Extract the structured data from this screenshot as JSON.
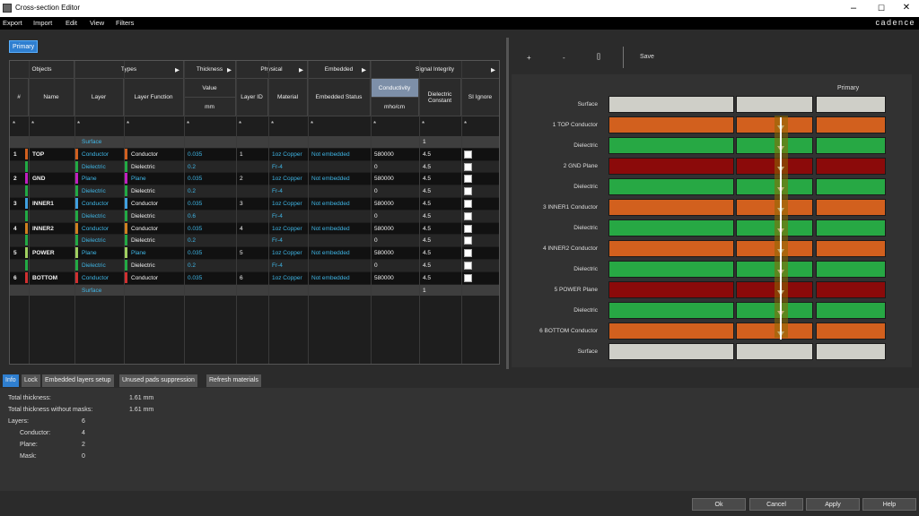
{
  "window": {
    "title": "Cross-section Editor",
    "min": "–",
    "max": "☐",
    "close": "✕",
    "brand": "cadence"
  },
  "menu": [
    "Export",
    "Import",
    "Edit",
    "View",
    "Filters"
  ],
  "primary_tab": "Primary",
  "headers": {
    "objects": "Objects",
    "types": "Types",
    "thickness": "Thickness",
    "physical": "Physical",
    "embedded": "Embedded",
    "signal_integrity": "Signal Integrity",
    "num": "#",
    "name": "Name",
    "layer": "Layer",
    "layer_function": "Layer Function",
    "value": "Value",
    "mm": "mm",
    "layer_id": "Layer ID",
    "material": "Material",
    "embedded_status": "Embedded Status",
    "conductivity": "Conductivity",
    "mho": "mho/cm",
    "dielectric_constant": "Dielectric Constant",
    "si_ignore": "SI Ignore",
    "star": "*"
  },
  "rows": [
    {
      "num": "",
      "name": "",
      "layer": "Surface",
      "func": "",
      "val": "",
      "id": "",
      "mat": "",
      "emb": "",
      "cond": "",
      "dk": "1",
      "chk": false,
      "type": "surface"
    },
    {
      "num": "1",
      "name": "TOP",
      "layer": "Conductor",
      "func": "Conductor",
      "val": "0.035",
      "id": "1",
      "mat": "1oz Copper",
      "emb": "Not embedded",
      "cond": "580000",
      "dk": "4.5",
      "chk": true,
      "type": "cond",
      "color": "#d06020"
    },
    {
      "num": "",
      "name": "",
      "layer": "Dielectric",
      "func": "Dielectric",
      "val": "0.2",
      "id": "",
      "mat": "Fr-4",
      "emb": "",
      "cond": "0",
      "dk": "4.5",
      "chk": true,
      "type": "diel",
      "color": "#22aa44"
    },
    {
      "num": "2",
      "name": "GND",
      "layer": "Plane",
      "func": "Plane",
      "val": "0.035",
      "id": "2",
      "mat": "1oz Copper",
      "emb": "Not embedded",
      "cond": "580000",
      "dk": "4.5",
      "chk": true,
      "type": "plane",
      "color": "#c020c0"
    },
    {
      "num": "",
      "name": "",
      "layer": "Dielectric",
      "func": "Dielectric",
      "val": "0.2",
      "id": "",
      "mat": "Fr-4",
      "emb": "",
      "cond": "0",
      "dk": "4.5",
      "chk": true,
      "type": "diel",
      "color": "#22aa44"
    },
    {
      "num": "3",
      "name": "INNER1",
      "layer": "Conductor",
      "func": "Conductor",
      "val": "0.035",
      "id": "3",
      "mat": "1oz Copper",
      "emb": "Not embedded",
      "cond": "580000",
      "dk": "4.5",
      "chk": true,
      "type": "cond",
      "color": "#40a0e0"
    },
    {
      "num": "",
      "name": "",
      "layer": "Dielectric",
      "func": "Dielectric",
      "val": "0.6",
      "id": "",
      "mat": "Fr-4",
      "emb": "",
      "cond": "0",
      "dk": "4.5",
      "chk": true,
      "type": "diel",
      "color": "#22aa44"
    },
    {
      "num": "4",
      "name": "INNER2",
      "layer": "Conductor",
      "func": "Conductor",
      "val": "0.035",
      "id": "4",
      "mat": "1oz Copper",
      "emb": "Not embedded",
      "cond": "580000",
      "dk": "4.5",
      "chk": true,
      "type": "cond",
      "color": "#d08020"
    },
    {
      "num": "",
      "name": "",
      "layer": "Dielectric",
      "func": "Dielectric",
      "val": "0.2",
      "id": "",
      "mat": "Fr-4",
      "emb": "",
      "cond": "0",
      "dk": "4.5",
      "chk": true,
      "type": "diel",
      "color": "#22aa44"
    },
    {
      "num": "5",
      "name": "POWER",
      "layer": "Plane",
      "func": "Plane",
      "val": "0.035",
      "id": "5",
      "mat": "1oz Copper",
      "emb": "Not embedded",
      "cond": "580000",
      "dk": "4.5",
      "chk": true,
      "type": "plane",
      "color": "#a0d060"
    },
    {
      "num": "",
      "name": "",
      "layer": "Dielectric",
      "func": "Dielectric",
      "val": "0.2",
      "id": "",
      "mat": "Fr-4",
      "emb": "",
      "cond": "0",
      "dk": "4.5",
      "chk": true,
      "type": "diel",
      "color": "#22aa44"
    },
    {
      "num": "6",
      "name": "BOTTOM",
      "layer": "Conductor",
      "func": "Conductor",
      "val": "0.035",
      "id": "6",
      "mat": "1oz Copper",
      "emb": "Not embedded",
      "cond": "580000",
      "dk": "4.5",
      "chk": true,
      "type": "cond",
      "color": "#d03030"
    },
    {
      "num": "",
      "name": "",
      "layer": "Surface",
      "func": "",
      "val": "",
      "id": "",
      "mat": "",
      "emb": "",
      "cond": "",
      "dk": "1",
      "chk": false,
      "type": "surface"
    }
  ],
  "toolbar": {
    "plus": "+",
    "minus": "-",
    "fit": "[]",
    "save": "Save"
  },
  "right": {
    "column_header": "Primary",
    "layers": [
      {
        "label": "Surface",
        "kind": "surface"
      },
      {
        "label": "1   TOP Conductor",
        "kind": "cond"
      },
      {
        "label": "Dielectric",
        "kind": "diel"
      },
      {
        "label": "2   GND Plane",
        "kind": "plane"
      },
      {
        "label": "Dielectric",
        "kind": "diel"
      },
      {
        "label": "3   INNER1 Conductor",
        "kind": "cond"
      },
      {
        "label": "Dielectric",
        "kind": "diel"
      },
      {
        "label": "4   INNER2 Conductor",
        "kind": "cond"
      },
      {
        "label": "Dielectric",
        "kind": "diel"
      },
      {
        "label": "5   POWER Plane",
        "kind": "plane"
      },
      {
        "label": "Dielectric",
        "kind": "diel"
      },
      {
        "label": "6   BOTTOM Conductor",
        "kind": "cond"
      },
      {
        "label": "Surface",
        "kind": "surface"
      }
    ],
    "colors": {
      "surface": "#cfcfc8",
      "cond": "#d2601e",
      "diel": "#27a844",
      "plane": "#8b0a0a"
    }
  },
  "bottom_tabs": [
    "Info",
    "Lock",
    "Embedded layers setup",
    "Unused pads suppression",
    "Refresh materials"
  ],
  "info": [
    {
      "label": "Total thickness:",
      "value": "1.61 mm"
    },
    {
      "label": "Total thickness without masks:",
      "value": "1.61 mm"
    },
    {
      "label": "Layers:",
      "value": "6"
    },
    {
      "label": "Conductor:",
      "value": "4"
    },
    {
      "label": "Plane:",
      "value": "2"
    },
    {
      "label": "Mask:",
      "value": "0"
    }
  ],
  "buttons": {
    "ok": "Ok",
    "cancel": "Cancel",
    "apply": "Apply",
    "help": "Help"
  }
}
